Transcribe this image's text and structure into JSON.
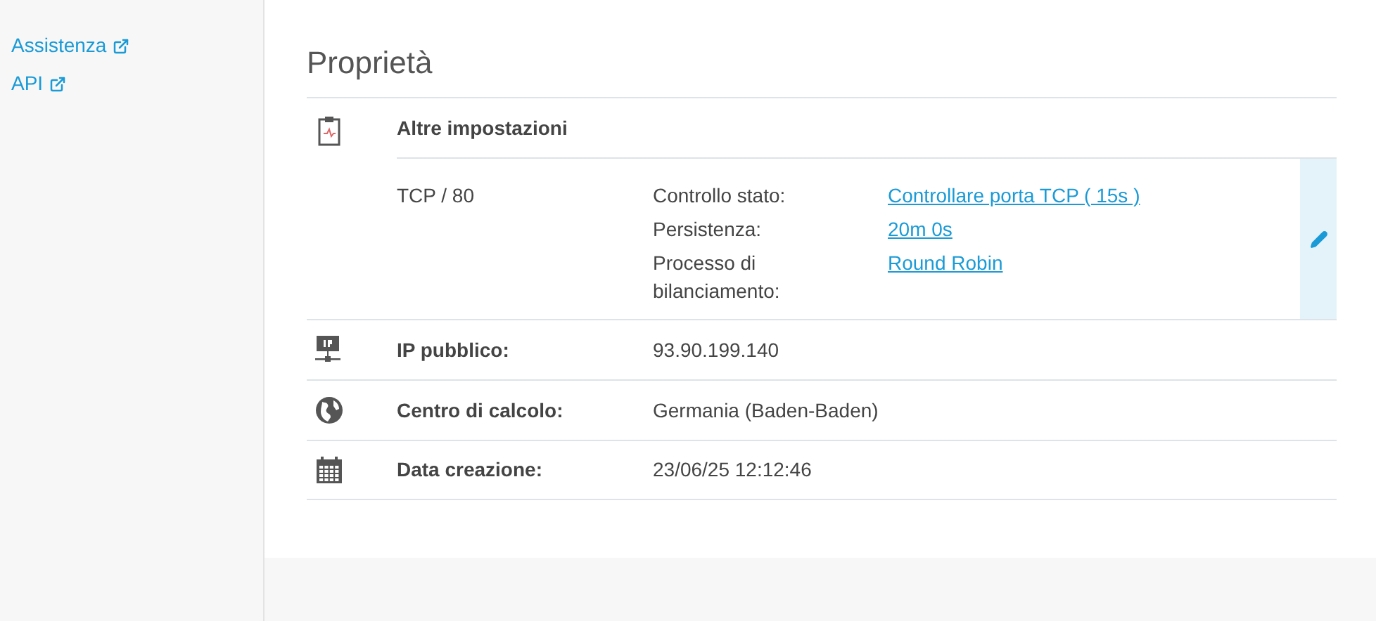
{
  "sidebar": {
    "links": [
      {
        "label": "Assistenza"
      },
      {
        "label": "API"
      }
    ]
  },
  "section": {
    "title": "Proprietà",
    "settings": {
      "title": "Altre impostazioni",
      "rule": "TCP / 80",
      "details": [
        {
          "label": "Controllo stato:",
          "value": "Controllare porta TCP ( 15s )"
        },
        {
          "label": "Persistenza:",
          "value": "20m 0s"
        },
        {
          "label": "Processo di bilanciamento:",
          "value": "Round Robin"
        }
      ]
    },
    "properties": [
      {
        "kind": "ip",
        "label": "IP pubblico:",
        "value": "93.90.199.140"
      },
      {
        "kind": "globe",
        "label": "Centro di calcolo:",
        "value": "Germania (Baden-Baden)"
      },
      {
        "kind": "calendar",
        "label": "Data creazione:",
        "value": "23/06/25 12:12:46"
      }
    ]
  }
}
